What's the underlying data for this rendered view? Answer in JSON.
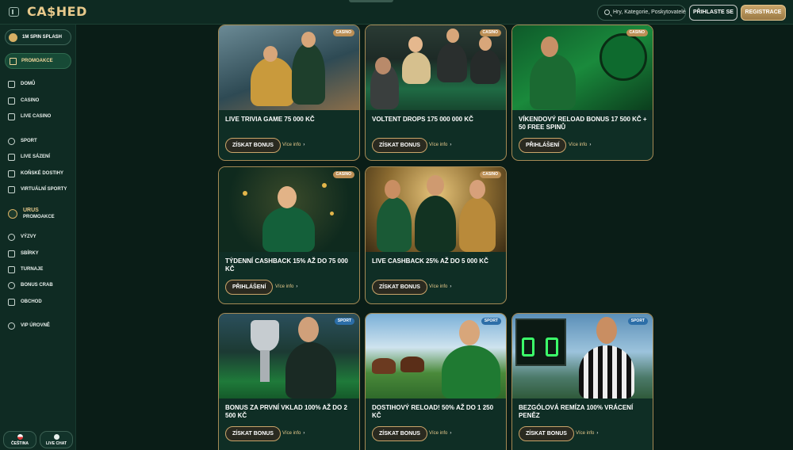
{
  "header": {
    "logo": "CA$HED",
    "search_placeholder": "Hry, Kategorie, Poskytovatelé",
    "login_label": "PŘIHLASTE SE",
    "register_label": "REGISTRACE"
  },
  "sidebar": {
    "spin_label": "1M SPIN SPLASH",
    "promo_label": "PROMOAKCE",
    "items": [
      {
        "label": "DOMŮ",
        "icon": "home-icon"
      },
      {
        "label": "CASINO",
        "icon": "casino-icon"
      },
      {
        "label": "LIVE CASINO",
        "icon": "live-casino-icon"
      },
      {
        "label": "SPORT",
        "icon": "sport-icon"
      },
      {
        "label": "LIVE SÁZENÍ",
        "icon": "live-betting-icon"
      },
      {
        "label": "KOŇSKÉ DOSTIHY",
        "icon": "horse-racing-icon"
      },
      {
        "label": "VIRTUÁLNÍ SPORTY",
        "icon": "virtual-sports-icon"
      }
    ],
    "urus_title": "URUS",
    "urus_sub": "PROMOAKCE",
    "items2": [
      {
        "label": "VÝZVY",
        "icon": "challenges-icon"
      },
      {
        "label": "SBÍRKY",
        "icon": "collections-icon"
      },
      {
        "label": "TURNAJE",
        "icon": "tournaments-icon"
      },
      {
        "label": "BONUS CRAB",
        "icon": "crab-icon"
      },
      {
        "label": "OBCHOD",
        "icon": "shop-icon"
      }
    ],
    "vip_label": "VIP ÚROVNĚ",
    "language_label": "ČEŠTINA",
    "livechat_label": "LIVE CHAT"
  },
  "cards": [
    {
      "badge": "CASINO",
      "title": "LIVE TRIVIA GAME 75 000 KČ",
      "button": "ZÍSKAT BONUS",
      "info": "Více info"
    },
    {
      "badge": "CASINO",
      "title": "VOLTENT DROPS 175 000 000 KČ",
      "button": "ZÍSKAT BONUS",
      "info": "Více info"
    },
    {
      "badge": "CASINO",
      "title": "VÍKENDOVÝ RELOAD BONUS 17 500 KČ + 50 FREE SPINŮ",
      "button": "PŘIHLÁŠENÍ",
      "info": "Více info"
    },
    {
      "badge": "CASINO",
      "title": "TÝDENNÍ CASHBACK 15% AŽ DO 75 000 KČ",
      "button": "PŘIHLÁŠENÍ",
      "info": "Více info"
    },
    {
      "badge": "CASINO",
      "title": "LIVE CASHBACK 25% AŽ DO 5 000 KČ",
      "button": "ZÍSKAT BONUS",
      "info": "Více info"
    },
    {
      "badge": "SPORT",
      "title": "BONUS ZA PRVNÍ VKLAD 100% AŽ DO 2 500 KČ",
      "button": "ZÍSKAT BONUS",
      "info": "Více info"
    },
    {
      "badge": "SPORT",
      "title": "DOSTIHOVÝ RELOAD! 50% AŽ DO 1 250 KČ",
      "button": "ZÍSKAT BONUS",
      "info": "Více info"
    },
    {
      "badge": "SPORT",
      "title": "BEZGÓLOVÁ REMÍZA 100% VRÁCENÍ PENĚZ",
      "button": "ZÍSKAT BONUS",
      "info": "Více info"
    }
  ],
  "colors": {
    "accent_gold": "#c9a56a",
    "background": "#0a1d17",
    "sport_badge": "#2c6ea8",
    "casino_badge": "#bc8f55"
  }
}
